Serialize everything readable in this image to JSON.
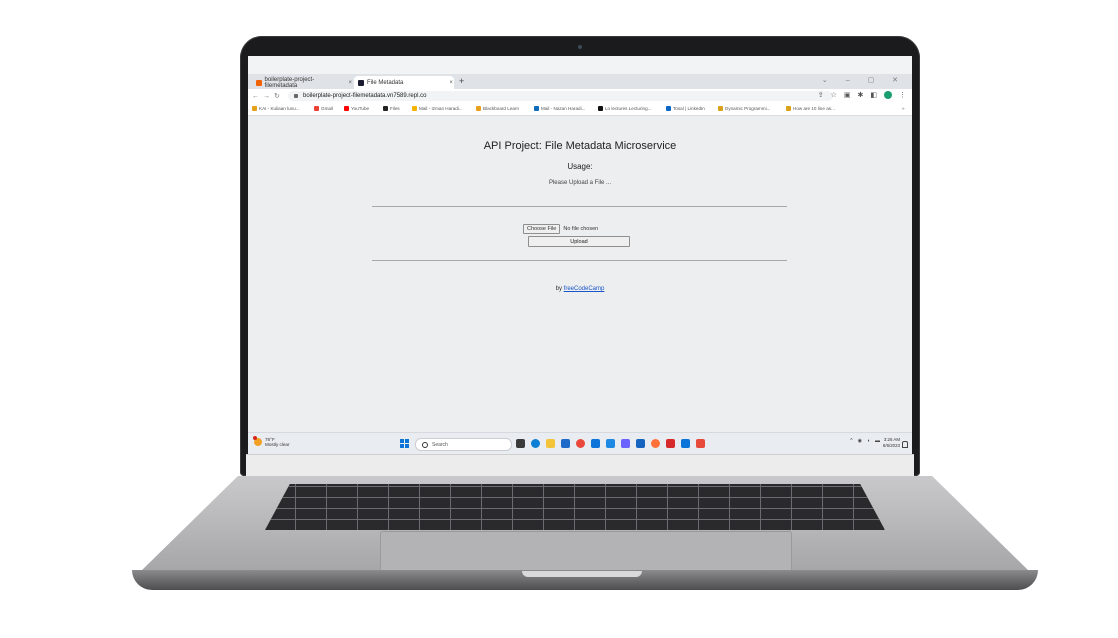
{
  "browser": {
    "tabs": [
      {
        "label": "boilerplate-project-filemetadata",
        "active": false,
        "icon_color": "#f26207"
      },
      {
        "label": "File Metadata",
        "active": true,
        "icon_color": "#1b1b32"
      }
    ],
    "new_tab": "+",
    "address": "boilerplate-project-filemetadata.vn7589.repl.co",
    "bookmarks": [
      {
        "label": "KAI - Kuliaan lunu...",
        "icon_color": "#e3a21a"
      },
      {
        "label": "Gmail",
        "icon_color": "#ea4335"
      },
      {
        "label": "YouTube",
        "icon_color": "#ff0000"
      },
      {
        "label": "Files",
        "icon_color": "#222222"
      },
      {
        "label": "Mail - Izman Haradi...",
        "icon_color": "#f4b400"
      },
      {
        "label": "Blackboard Learn",
        "icon_color": "#e8a01c"
      },
      {
        "label": "Mail - Nazan Haradi...",
        "icon_color": "#0f6cbd"
      },
      {
        "label": "Lo lectures Lecturing...",
        "icon_color": "#111111"
      },
      {
        "label": "Tosal | LinkedIn",
        "icon_color": "#0a66c2"
      },
      {
        "label": "Dynamic Programmi...",
        "icon_color": "#d9a21a"
      },
      {
        "label": "How are 10 line as...",
        "icon_color": "#d9a21a"
      }
    ]
  },
  "page": {
    "title": "API Project: File Metadata Microservice",
    "usage_heading": "Usage:",
    "usage_text": "Please Upload a File ...",
    "choose_file_label": "Choose File",
    "no_file_text": "No file chosen",
    "upload_label": "Upload",
    "footer_prefix": "by",
    "footer_link": "freeCodeCamp"
  },
  "taskbar": {
    "weather_temp": "78°F",
    "weather_desc": "Mostly clear",
    "search_placeholder": "Search",
    "time": "3:26 AM",
    "date": "8/6/2023",
    "app_colors": [
      "#3a3a3a",
      "#0c7fd5",
      "#f3c43a",
      "#1e6ac9",
      "#e9483b",
      "#0a74d9",
      "#1e88e5",
      "#6b62ff",
      "#1565c0",
      "#ff7139",
      "#d72b2b",
      "#0a74d9",
      "#e84a3c"
    ]
  }
}
